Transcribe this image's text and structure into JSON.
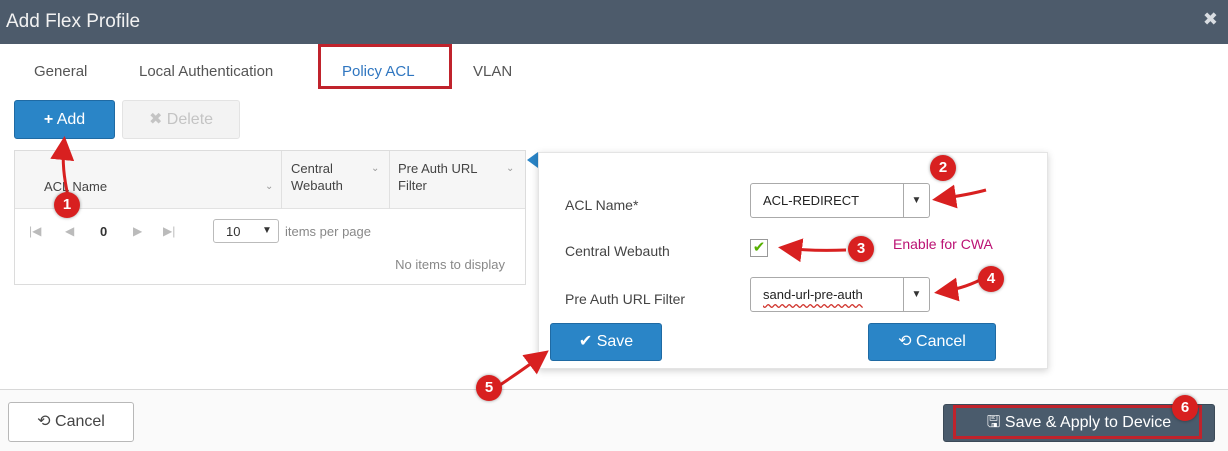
{
  "window": {
    "title": "Add Flex Profile",
    "close_icon": "close-icon"
  },
  "tabs": [
    {
      "label": "General",
      "active": false
    },
    {
      "label": "Local Authentication",
      "active": false
    },
    {
      "label": "Policy ACL",
      "active": true
    },
    {
      "label": "VLAN",
      "active": false
    }
  ],
  "toolbar": {
    "add_label": "Add",
    "delete_label": "Delete"
  },
  "grid": {
    "columns": [
      {
        "label_line1": "ACL Name",
        "label_line2": ""
      },
      {
        "label_line1": "Central",
        "label_line2": "Webauth"
      },
      {
        "label_line1": "Pre Auth URL",
        "label_line2": "Filter"
      }
    ],
    "pager": {
      "page": "0",
      "page_size": "10",
      "per_page_label": "items per page"
    },
    "empty_text": "No items to display"
  },
  "form": {
    "acl_name_label": "ACL Name*",
    "acl_name_value": "ACL-REDIRECT",
    "central_webauth_label": "Central Webauth",
    "central_webauth_checked": true,
    "enable_note": "Enable for CWA",
    "pre_auth_label": "Pre Auth URL Filter",
    "pre_auth_value": "sand-url-pre-auth",
    "save_label": "Save",
    "cancel_label": "Cancel"
  },
  "footer": {
    "cancel_label": "Cancel",
    "save_apply_label": "Save & Apply to Device"
  },
  "annotations": [
    "1",
    "2",
    "3",
    "4",
    "5",
    "6"
  ],
  "colors": {
    "titlebar": "#4d5b6b",
    "primary": "#2a85c7",
    "active_tab": "#2f76c0",
    "highlight": "#c0232c",
    "badge": "#d82020",
    "note": "#bb1173",
    "dark_button": "#4a5b6c"
  }
}
